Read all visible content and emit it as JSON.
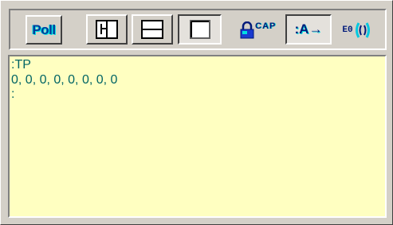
{
  "toolbar": {
    "poll_label": "Poll",
    "cap_label": "CAP",
    "tx_label": ":A→",
    "eo_label": "E0"
  },
  "terminal": {
    "lines": [
      ":TP",
      "0, 0, 0, 0, 0, 0, 0, 0",
      ":"
    ]
  },
  "colors": {
    "terminal_background": "#ffffc1",
    "terminal_text": "#006464",
    "icon_blue": "#001a7a",
    "icon_cyan": "#00e0e0"
  },
  "icons": [
    "poll-icon",
    "split-vertical-icon",
    "split-horizontal-icon",
    "single-pane-icon",
    "lock-caps-icon",
    "send-arrow-icon",
    "eo-signal-icon"
  ]
}
